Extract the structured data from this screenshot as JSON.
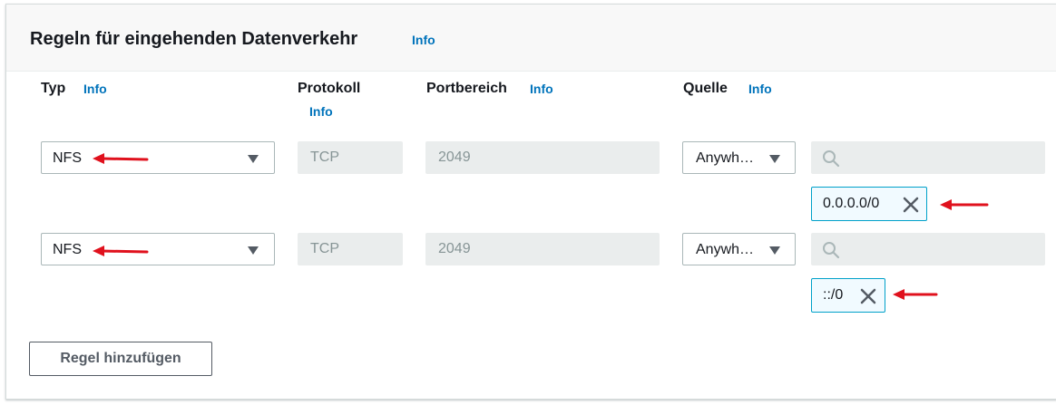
{
  "section": {
    "title": "Regeln für eingehenden Datenverkehr",
    "info": "Info"
  },
  "columns": {
    "type": "Typ",
    "type_info": "Info",
    "protocol": "Protokoll",
    "protocol_info": "Info",
    "port_range": "Portbereich",
    "port_range_info": "Info",
    "source": "Quelle",
    "source_info": "Info"
  },
  "rules": [
    {
      "type": "NFS",
      "protocol": "TCP",
      "port_range": "2049",
      "source": "Anywh…",
      "cidr": "0.0.0.0/0"
    },
    {
      "type": "NFS",
      "protocol": "TCP",
      "port_range": "2049",
      "source": "Anywh…",
      "cidr": "::/0"
    }
  ],
  "add_rule_label": "Regel hinzufügen",
  "colors": {
    "link": "#0073bb",
    "annotation_arrow": "#e0111d",
    "token_border": "#00a1c9"
  },
  "icons": [
    "caret-down-icon",
    "search-icon",
    "close-icon",
    "annotation-arrow-icon"
  ]
}
